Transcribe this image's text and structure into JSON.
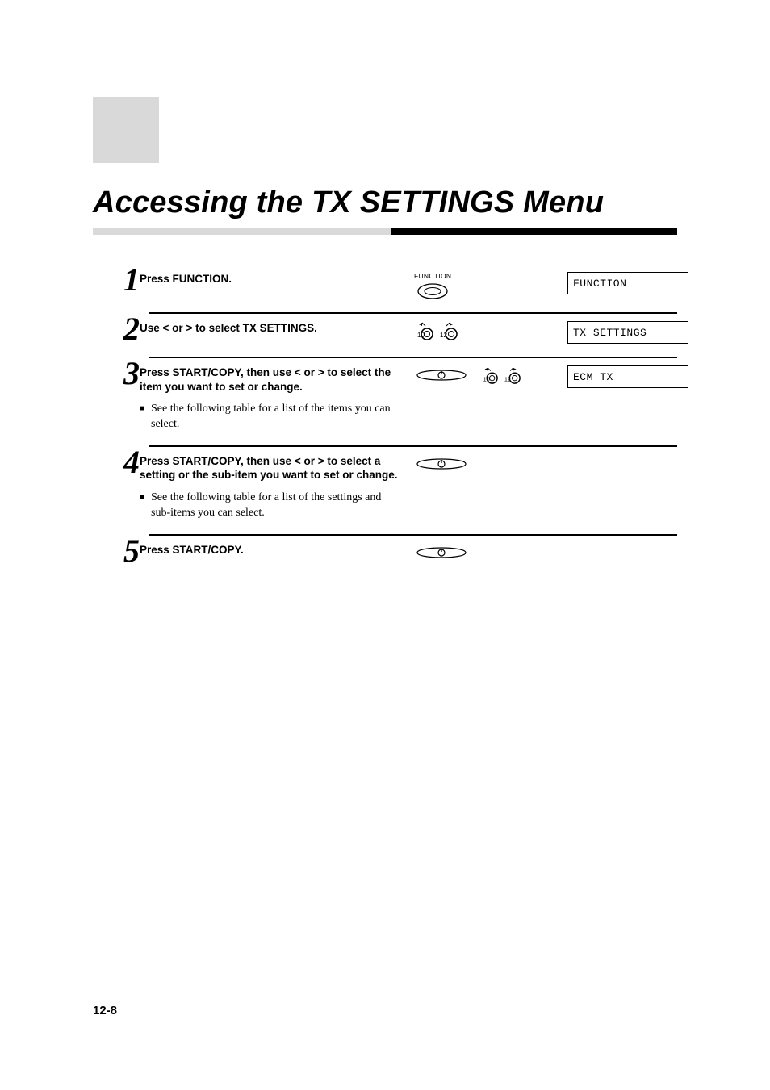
{
  "title": "Accessing the TX SETTINGS Menu",
  "footer": "12-8",
  "functionLabel": "FUNCTION",
  "steps": [
    {
      "num": "1",
      "heading": "Press FUNCTION.",
      "bullet": null,
      "icons": "function",
      "display": "FUNCTION"
    },
    {
      "num": "2",
      "heading": "Use < or > to select TX SETTINGS.",
      "bullet": null,
      "icons": "arrows",
      "display": "TX SETTINGS"
    },
    {
      "num": "3",
      "heading": "Press START/COPY, then use < or > to select the item you want to set or change.",
      "bullet": "See the following table for a list of the items you can select.",
      "icons": "start-then-arrows",
      "display": "ECM TX"
    },
    {
      "num": "4",
      "heading": "Press START/COPY, then use < or > to select a setting or the sub-item you want to set or change.",
      "bullet": "See the following table for a list of the settings and sub-items you can select.",
      "icons": "start",
      "display": null
    },
    {
      "num": "5",
      "heading": "Press START/COPY.",
      "bullet": null,
      "icons": "start",
      "display": null
    }
  ],
  "arrowNums": {
    "left": "10",
    "right": "12"
  }
}
